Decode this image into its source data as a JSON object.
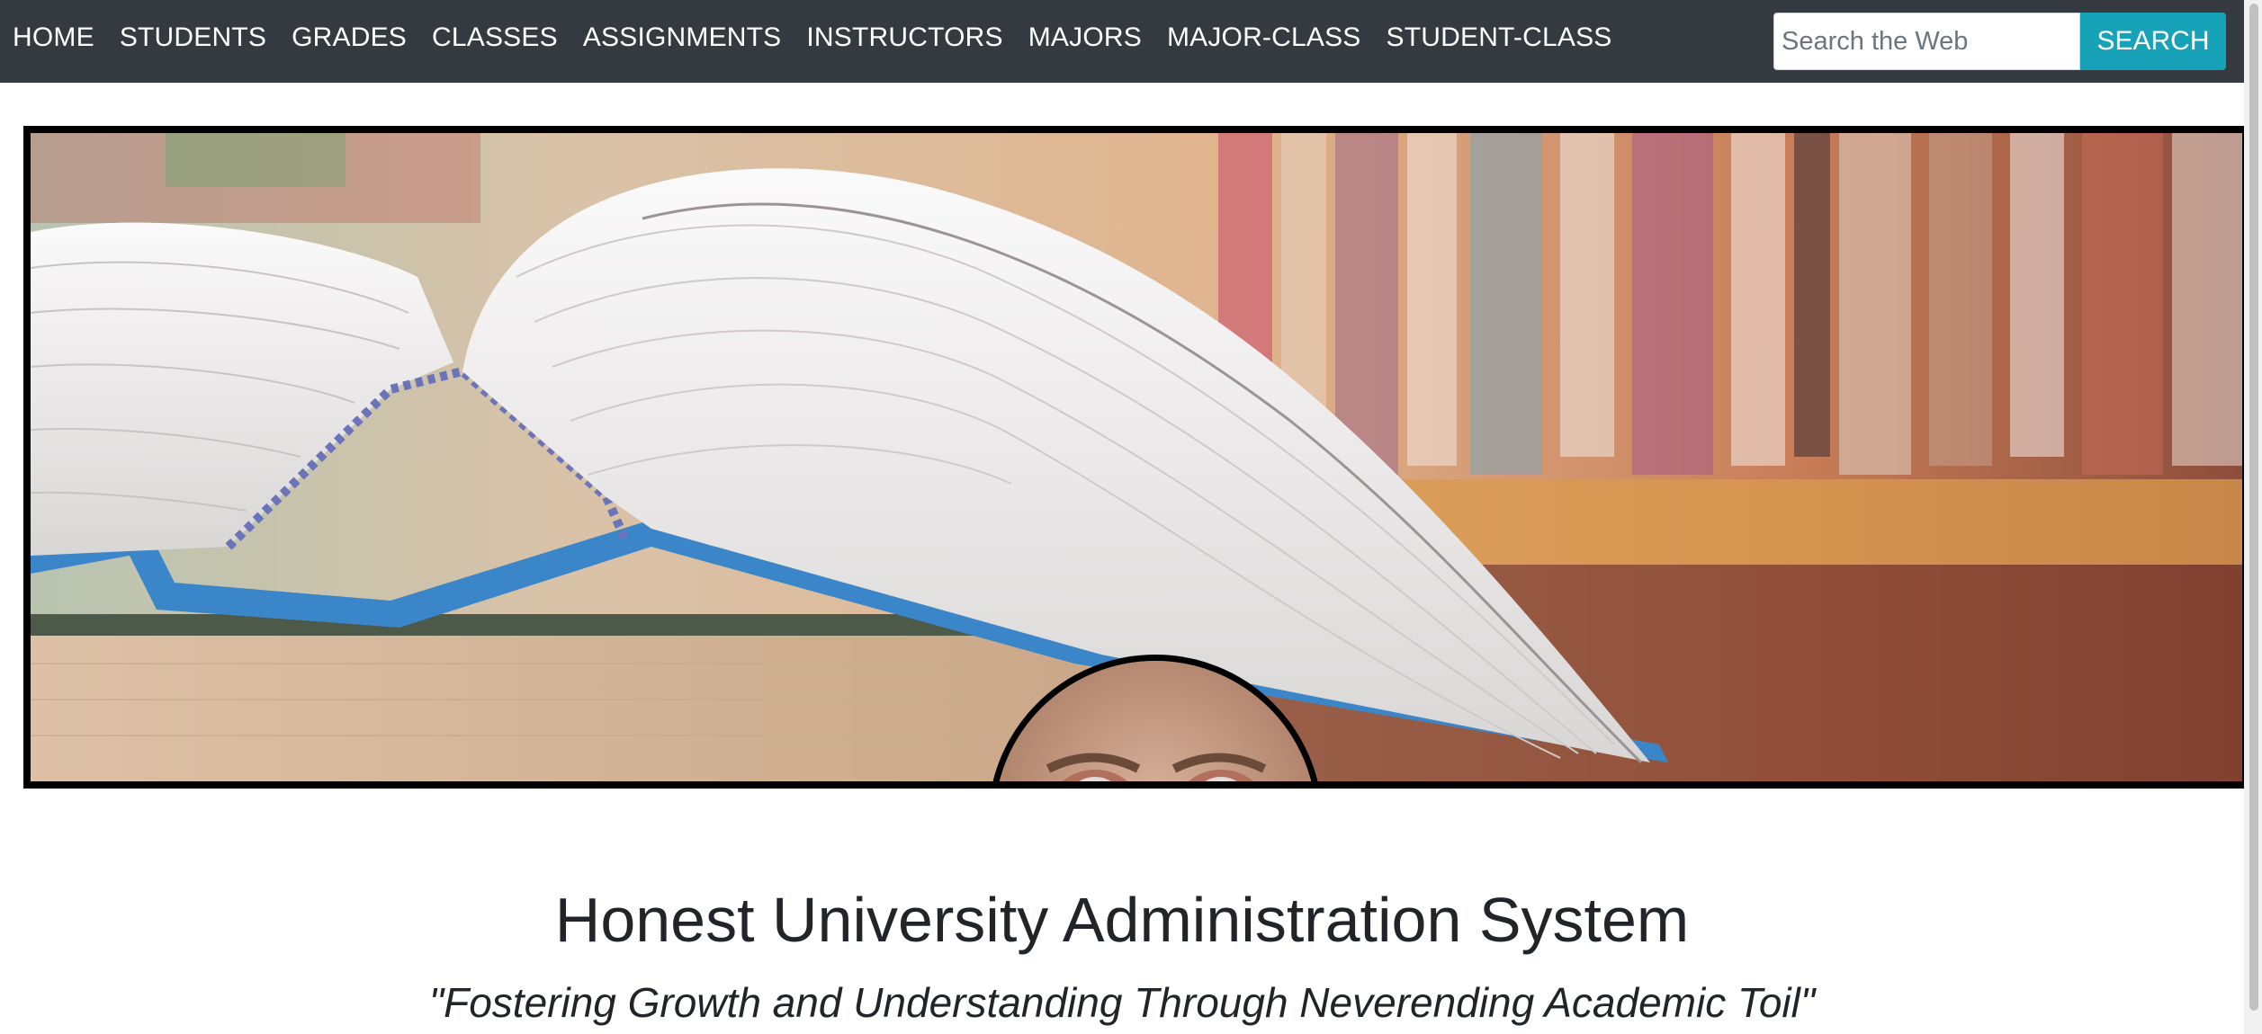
{
  "nav": {
    "items": [
      {
        "label": "HOME"
      },
      {
        "label": "STUDENTS"
      },
      {
        "label": "GRADES"
      },
      {
        "label": "CLASSES"
      },
      {
        "label": "ASSIGNMENTS"
      },
      {
        "label": "INSTRUCTORS"
      },
      {
        "label": "MAJORS"
      },
      {
        "label": "MAJOR-CLASS"
      },
      {
        "label": "STUDENT-CLASS"
      }
    ]
  },
  "search": {
    "placeholder": "Search the Web",
    "value": "",
    "button_label": "SEARCH"
  },
  "hero": {
    "image": "open-book-photo",
    "avatar": "bulging-eyes-face-photo"
  },
  "main": {
    "title": "Honest University Administration System",
    "tagline": "\"Fostering Growth and Understanding Through Neverending Academic Toil\""
  },
  "colors": {
    "navbar_bg": "#343a40",
    "nav_text": "#ffffff",
    "search_button": "#17a2b8",
    "hero_border": "#000000",
    "text": "#212529"
  }
}
